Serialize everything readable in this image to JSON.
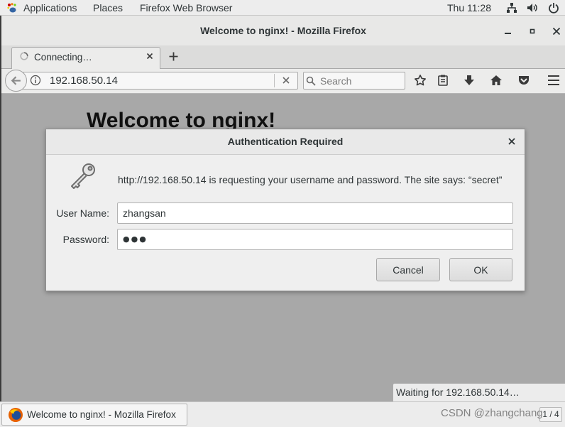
{
  "top_panel": {
    "applications_label": "Applications",
    "places_label": "Places",
    "app_menu_label": "Firefox Web Browser",
    "clock": "Thu 11:28",
    "icons": {
      "applications": "gnome-foot-icon",
      "network": "network-icon",
      "volume": "volume-icon",
      "power": "power-icon"
    }
  },
  "window": {
    "title": "Welcome to nginx! - Mozilla Firefox",
    "controls": [
      "minimize-icon",
      "maximize-icon",
      "close-icon"
    ]
  },
  "tabs": [
    {
      "label": "Connecting…",
      "active": true,
      "icon": "loading-spinner-icon"
    }
  ],
  "navbar": {
    "url": "192.168.50.14",
    "search_placeholder": "Search",
    "icons": [
      "back-arrow-icon",
      "site-info-icon",
      "clear-url-icon",
      "search-icon",
      "bookmark-star-icon",
      "library-icon",
      "download-icon",
      "home-icon",
      "pocket-icon",
      "hamburger-menu-icon"
    ]
  },
  "page": {
    "heading": "Welcome to nginx!"
  },
  "auth_dialog": {
    "title": "Authentication Required",
    "icon": "key-icon",
    "message": "http://192.168.50.14 is requesting your username and password. The site says: “secret”",
    "username_label": "User Name:",
    "username_value": "zhangsan",
    "password_label": "Password:",
    "password_mask": "●●●",
    "cancel_label": "Cancel",
    "ok_label": "OK"
  },
  "status_panel": {
    "text": "Waiting for 192.168.50.14…"
  },
  "taskbar": {
    "task_label": "Welcome to nginx! - Mozilla Firefox",
    "task_icon": "firefox-icon",
    "workspace": "1 / 4"
  },
  "watermark": "CSDN @zhangchang",
  "colors": {
    "panel_bg": "#ededed",
    "chrome_bg": "#ececeb",
    "content_dimmed": "#a8a8a8",
    "dialog_bg": "#efefef",
    "text": "#2e3436"
  }
}
